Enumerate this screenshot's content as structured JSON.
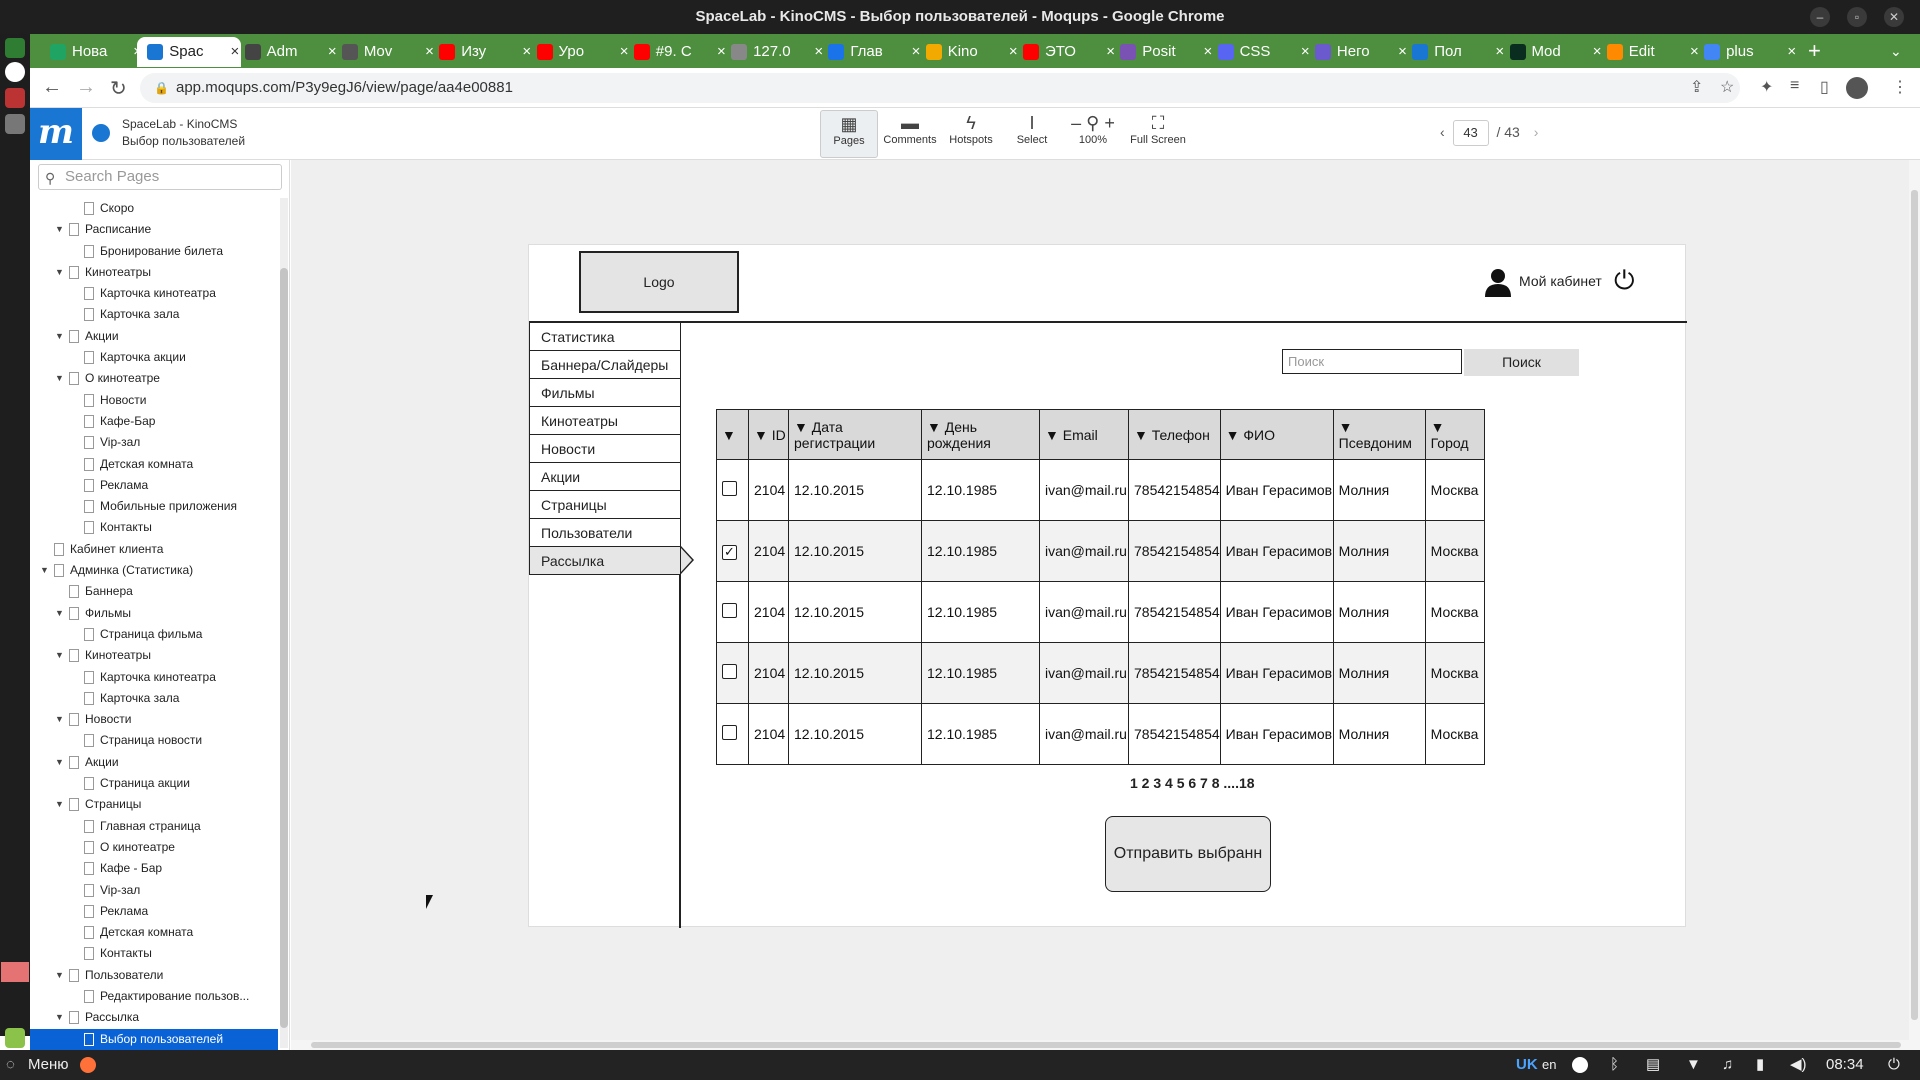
{
  "window": {
    "title": "SpaceLab - KinoCMS - Выбор пользователей - Moqups - Google Chrome"
  },
  "tabs": [
    {
      "label": "Нова",
      "color": "#1fa463",
      "active": false
    },
    {
      "label": "Spac",
      "color": "#1976d2",
      "active": true
    },
    {
      "label": "Adm",
      "color": "#444444",
      "active": false
    },
    {
      "label": "Mov",
      "color": "#555555",
      "active": false
    },
    {
      "label": "Изу",
      "color": "#ff0000",
      "active": false
    },
    {
      "label": "Уро",
      "color": "#ff0000",
      "active": false
    },
    {
      "label": "#9. С",
      "color": "#ff0000",
      "active": false
    },
    {
      "label": "127.0",
      "color": "#888888",
      "active": false
    },
    {
      "label": "Глав",
      "color": "#1a73e8",
      "active": false
    },
    {
      "label": "Kino",
      "color": "#f2a900",
      "active": false
    },
    {
      "label": "ЭТО",
      "color": "#ff0000",
      "active": false
    },
    {
      "label": "Posit",
      "color": "#7952b3",
      "active": false
    },
    {
      "label": "CSS",
      "color": "#5865f2",
      "active": false
    },
    {
      "label": "Него",
      "color": "#6a5acd",
      "active": false
    },
    {
      "label": "Пол",
      "color": "#1976d2",
      "active": false
    },
    {
      "label": "Mod",
      "color": "#092e20",
      "active": false
    },
    {
      "label": "Edit",
      "color": "#ff8a00",
      "active": false
    },
    {
      "label": "plus",
      "color": "#4285f4",
      "active": false
    }
  ],
  "address": {
    "url": "app.moqups.com/P3y9egJ6/view/page/aa4e00881"
  },
  "moqups": {
    "logo": "m",
    "project_title": "SpaceLab - KinoCMS",
    "page_title": "Выбор пользователей",
    "tools": {
      "pages": "Pages",
      "comments": "Comments",
      "hotspots": "Hotspots",
      "select": "Select",
      "zoom": "100%",
      "fullscreen": "Full Screen"
    },
    "pager": {
      "current": "43",
      "total": "/ 43"
    }
  },
  "sidebar": {
    "search_placeholder": "Search Pages",
    "tree": [
      {
        "label": "Скоро",
        "level": 2,
        "arrow": false
      },
      {
        "label": "Расписание",
        "level": 1,
        "arrow": true
      },
      {
        "label": "Бронирование билета",
        "level": 2,
        "arrow": false
      },
      {
        "label": "Кинотеатры",
        "level": 1,
        "arrow": true
      },
      {
        "label": "Карточка кинотеатра",
        "level": 2,
        "arrow": false
      },
      {
        "label": "Карточка зала",
        "level": 2,
        "arrow": false
      },
      {
        "label": "Акции",
        "level": 1,
        "arrow": true
      },
      {
        "label": "Карточка акции",
        "level": 2,
        "arrow": false
      },
      {
        "label": "О кинотеатре",
        "level": 1,
        "arrow": true
      },
      {
        "label": "Новости",
        "level": 2,
        "arrow": false
      },
      {
        "label": "Кафе-Бар",
        "level": 2,
        "arrow": false
      },
      {
        "label": "Vip-зал",
        "level": 2,
        "arrow": false
      },
      {
        "label": "Детская комната",
        "level": 2,
        "arrow": false
      },
      {
        "label": "Реклама",
        "level": 2,
        "arrow": false
      },
      {
        "label": "Мобильные приложения",
        "level": 2,
        "arrow": false
      },
      {
        "label": "Контакты",
        "level": 2,
        "arrow": false
      },
      {
        "label": "Кабинет клиента",
        "level": 0,
        "arrow": false
      },
      {
        "label": "Админка (Статистика)",
        "level": 0,
        "arrow": true
      },
      {
        "label": "Баннера",
        "level": 1,
        "arrow": false
      },
      {
        "label": "Фильмы",
        "level": 1,
        "arrow": true
      },
      {
        "label": "Страница фильма",
        "level": 2,
        "arrow": false
      },
      {
        "label": "Кинотеатры",
        "level": 1,
        "arrow": true
      },
      {
        "label": "Карточка кинотеатра",
        "level": 2,
        "arrow": false
      },
      {
        "label": "Карточка зала",
        "level": 2,
        "arrow": false
      },
      {
        "label": "Новости",
        "level": 1,
        "arrow": true
      },
      {
        "label": "Страница новости",
        "level": 2,
        "arrow": false
      },
      {
        "label": "Акции",
        "level": 1,
        "arrow": true
      },
      {
        "label": "Страница акции",
        "level": 2,
        "arrow": false
      },
      {
        "label": "Страницы",
        "level": 1,
        "arrow": true
      },
      {
        "label": "Главная страница",
        "level": 2,
        "arrow": false
      },
      {
        "label": "О кинотеатре",
        "level": 2,
        "arrow": false
      },
      {
        "label": "Кафе - Бар",
        "level": 2,
        "arrow": false
      },
      {
        "label": "Vip-зал",
        "level": 2,
        "arrow": false
      },
      {
        "label": "Реклама",
        "level": 2,
        "arrow": false
      },
      {
        "label": "Детская комната",
        "level": 2,
        "arrow": false
      },
      {
        "label": "Контакты",
        "level": 2,
        "arrow": false
      },
      {
        "label": "Пользователи",
        "level": 1,
        "arrow": true
      },
      {
        "label": "Редактирование пользов...",
        "level": 2,
        "arrow": false
      },
      {
        "label": "Рассылка",
        "level": 1,
        "arrow": true
      },
      {
        "label": "Выбор пользователей",
        "level": 2,
        "arrow": false,
        "selected": true
      }
    ]
  },
  "wireframe": {
    "logo": "Logo",
    "cabinet": "Мой кабинет",
    "menu": [
      "Статистика",
      "Баннера/Слайдеры",
      "Фильмы",
      "Кинотеатры",
      "Новости",
      "Акции",
      "Страницы",
      "Пользователи",
      "Рассылка"
    ],
    "active_menu": "Рассылка",
    "search_placeholder": "Поиск",
    "search_button": "Поиск",
    "table": {
      "headers": [
        "▼",
        "▼ ID",
        "▼ Дата регистрации",
        "▼ День рождения",
        "▼ Email",
        "▼ Телефон",
        "▼ ФИО",
        "▼ Псевдоним",
        "▼ Город"
      ],
      "rows": [
        {
          "checked": false,
          "cells": [
            "2104",
            "12.10.2015",
            "12.10.1985",
            "ivan@mail.ru",
            "78542154854",
            "Иван Герасимов",
            "Молния",
            "Москва"
          ]
        },
        {
          "checked": true,
          "cells": [
            "2104",
            "12.10.2015",
            "12.10.1985",
            "ivan@mail.ru",
            "78542154854",
            "Иван Герасимов",
            "Молния",
            "Москва"
          ]
        },
        {
          "checked": false,
          "cells": [
            "2104",
            "12.10.2015",
            "12.10.1985",
            "ivan@mail.ru",
            "78542154854",
            "Иван Герасимов",
            "Молния",
            "Москва"
          ]
        },
        {
          "checked": false,
          "cells": [
            "2104",
            "12.10.2015",
            "12.10.1985",
            "ivan@mail.ru",
            "78542154854",
            "Иван Герасимов",
            "Молния",
            "Москва"
          ]
        },
        {
          "checked": false,
          "cells": [
            "2104",
            "12.10.2015",
            "12.10.1985",
            "ivan@mail.ru",
            "78542154854",
            "Иван Герасимов",
            "Молния",
            "Москва"
          ]
        }
      ]
    },
    "pagination": "1 2 3 4 5 6 7 8 ....18",
    "send_button": "Отправить выбранн"
  },
  "taskbar": {
    "menu": "Меню",
    "lang1": "UK",
    "lang2": "en",
    "time": "08:34"
  }
}
